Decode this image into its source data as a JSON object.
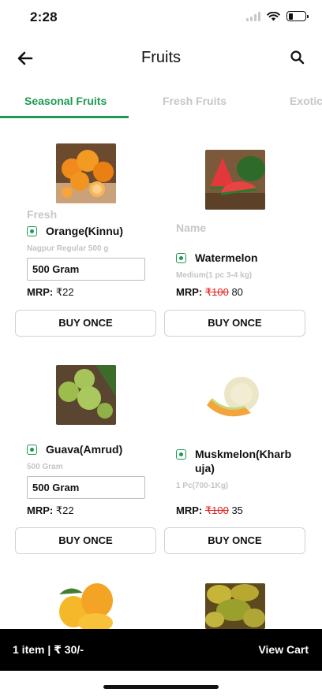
{
  "status_bar": {
    "time": "2:28",
    "battery_level": 0.28
  },
  "header": {
    "title": "Fruits",
    "back_icon": "arrow-left-icon",
    "search_icon": "search-icon"
  },
  "tabs": [
    {
      "label": "Seasonal Fruits",
      "active": true
    },
    {
      "label": "Fresh Fruits",
      "active": false
    },
    {
      "label": "Exotic",
      "active": false
    }
  ],
  "products": [
    {
      "name": "Orange(Kinnu)",
      "tagline": "Fresh",
      "description": "Nagpur Regular 500 g",
      "quantity": "500 Gram",
      "mrp_label": "MRP:",
      "price": "₹22",
      "old_price": "",
      "button": "BUY ONCE"
    },
    {
      "name": "Watermelon",
      "tagline": "Name",
      "description": "Medium(1 pc 3-4 kg)",
      "quantity": "",
      "mrp_label": "MRP:",
      "price": "80",
      "old_price": "₹100",
      "button": "BUY ONCE"
    },
    {
      "name": "Guava(Amrud)",
      "tagline": "",
      "description": "500 Gram",
      "quantity": "500 Gram",
      "mrp_label": "MRP:",
      "price": "₹22",
      "old_price": "",
      "button": "BUY ONCE"
    },
    {
      "name_line1": "Muskmelon(Kharb",
      "name_line2": "uja)",
      "tagline": "",
      "description": "1 Pc(700-1Kg)",
      "quantity": "",
      "mrp_label": "MRP:",
      "price": "35",
      "old_price": "₹100",
      "button": "BUY ONCE"
    }
  ],
  "cart": {
    "summary": "1 item | ₹ 30/-",
    "action": "View Cart"
  },
  "colors": {
    "accent": "#1c9a52",
    "old_price": "#e02020",
    "cart_bar": "#000000"
  }
}
